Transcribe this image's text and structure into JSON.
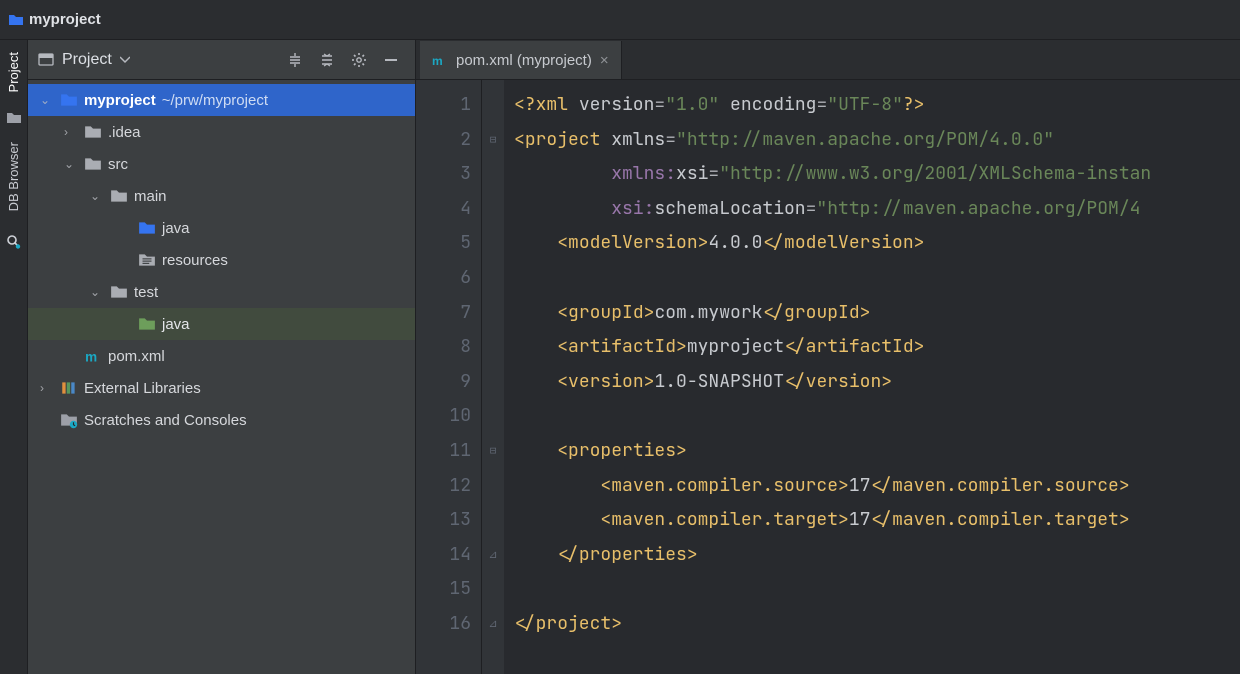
{
  "breadcrumb": {
    "project_name": "myproject"
  },
  "toolstrip": {
    "project_label": "Project",
    "db_label": "DB Browser"
  },
  "project_panel": {
    "title": "Project",
    "tree": [
      {
        "depth": 0,
        "arrow": "down",
        "icon": "folder-blue",
        "label": "myproject",
        "extra": "~/prw/myproject",
        "sel": "blue"
      },
      {
        "depth": 1,
        "arrow": "right",
        "icon": "folder",
        "label": ".idea"
      },
      {
        "depth": 1,
        "arrow": "down",
        "icon": "folder",
        "label": "src"
      },
      {
        "depth": 2,
        "arrow": "down",
        "icon": "folder",
        "label": "main"
      },
      {
        "depth": 3,
        "arrow": "none",
        "icon": "folder-blue",
        "label": "java"
      },
      {
        "depth": 3,
        "arrow": "none",
        "icon": "folder-res",
        "label": "resources"
      },
      {
        "depth": 2,
        "arrow": "down",
        "icon": "folder",
        "label": "test"
      },
      {
        "depth": 3,
        "arrow": "none",
        "icon": "folder-green",
        "label": "java",
        "sel": "green"
      },
      {
        "depth": 1,
        "arrow": "none",
        "icon": "maven",
        "label": "pom.xml"
      },
      {
        "depth": 0,
        "arrow": "right",
        "icon": "libraries",
        "label": "External Libraries"
      },
      {
        "depth": 0,
        "arrow": "none",
        "icon": "scratches",
        "label": "Scratches and Consoles"
      }
    ]
  },
  "editor": {
    "tab": {
      "icon": "maven",
      "label": "pom.xml (myproject)"
    },
    "lines": 16,
    "fold_marks": {
      "2": "open",
      "11": "open",
      "14": "close",
      "16": "close"
    },
    "code": [
      [
        [
          "pi",
          "<?"
        ],
        [
          "tag",
          "xml "
        ],
        [
          "attr",
          "version"
        ],
        [
          "eq",
          "="
        ],
        [
          "str",
          "\"1.0\" "
        ],
        [
          "attr",
          "encoding"
        ],
        [
          "eq",
          "="
        ],
        [
          "str",
          "\"UTF-8\""
        ],
        [
          "pi",
          "?>"
        ]
      ],
      [
        [
          "ang",
          "<"
        ],
        [
          "tag",
          "project "
        ],
        [
          "attr",
          "xmlns"
        ],
        [
          "eq",
          "="
        ],
        [
          "str",
          "\"http://maven.apache.org/POM/4.0.0\""
        ]
      ],
      [
        [
          "txt",
          "         "
        ],
        [
          "ns",
          "xmlns:"
        ],
        [
          "attr",
          "xsi"
        ],
        [
          "eq",
          "="
        ],
        [
          "str",
          "\"http://www.w3.org/2001/XMLSchema-instan"
        ]
      ],
      [
        [
          "txt",
          "         "
        ],
        [
          "ns",
          "xsi:"
        ],
        [
          "attr",
          "schemaLocation"
        ],
        [
          "eq",
          "="
        ],
        [
          "str",
          "\"http://maven.apache.org/POM/4"
        ]
      ],
      [
        [
          "txt",
          "    "
        ],
        [
          "ang",
          "<"
        ],
        [
          "tag",
          "modelVersion"
        ],
        [
          "ang",
          ">"
        ],
        [
          "txt",
          "4.0.0"
        ],
        [
          "ang",
          "</"
        ],
        [
          "tag",
          "modelVersion"
        ],
        [
          "ang",
          ">"
        ]
      ],
      [],
      [
        [
          "txt",
          "    "
        ],
        [
          "ang",
          "<"
        ],
        [
          "tag",
          "groupId"
        ],
        [
          "ang",
          ">"
        ],
        [
          "txt",
          "com.mywork"
        ],
        [
          "ang",
          "</"
        ],
        [
          "tag",
          "groupId"
        ],
        [
          "ang",
          ">"
        ]
      ],
      [
        [
          "txt",
          "    "
        ],
        [
          "ang",
          "<"
        ],
        [
          "tag",
          "artifactId"
        ],
        [
          "ang",
          ">"
        ],
        [
          "txt",
          "myproject"
        ],
        [
          "ang",
          "</"
        ],
        [
          "tag",
          "artifactId"
        ],
        [
          "ang",
          ">"
        ]
      ],
      [
        [
          "txt",
          "    "
        ],
        [
          "ang",
          "<"
        ],
        [
          "tag",
          "version"
        ],
        [
          "ang",
          ">"
        ],
        [
          "txt",
          "1.0-SNAPSHOT"
        ],
        [
          "ang",
          "</"
        ],
        [
          "tag",
          "version"
        ],
        [
          "ang",
          ">"
        ]
      ],
      [],
      [
        [
          "txt",
          "    "
        ],
        [
          "ang",
          "<"
        ],
        [
          "tag",
          "properties"
        ],
        [
          "ang",
          ">"
        ]
      ],
      [
        [
          "txt",
          "        "
        ],
        [
          "ang",
          "<"
        ],
        [
          "tag",
          "maven.compiler.source"
        ],
        [
          "ang",
          ">"
        ],
        [
          "txt",
          "17"
        ],
        [
          "ang",
          "</"
        ],
        [
          "tag",
          "maven.compiler.source"
        ],
        [
          "ang",
          ">"
        ]
      ],
      [
        [
          "txt",
          "        "
        ],
        [
          "ang",
          "<"
        ],
        [
          "tag",
          "maven.compiler.target"
        ],
        [
          "ang",
          ">"
        ],
        [
          "txt",
          "17"
        ],
        [
          "ang",
          "</"
        ],
        [
          "tag",
          "maven.compiler.target"
        ],
        [
          "ang",
          ">"
        ]
      ],
      [
        [
          "txt",
          "    "
        ],
        [
          "ang",
          "</"
        ],
        [
          "tag",
          "properties"
        ],
        [
          "ang",
          ">"
        ]
      ],
      [],
      [
        [
          "ang",
          "</"
        ],
        [
          "tag",
          "project"
        ],
        [
          "ang",
          ">"
        ]
      ]
    ]
  }
}
